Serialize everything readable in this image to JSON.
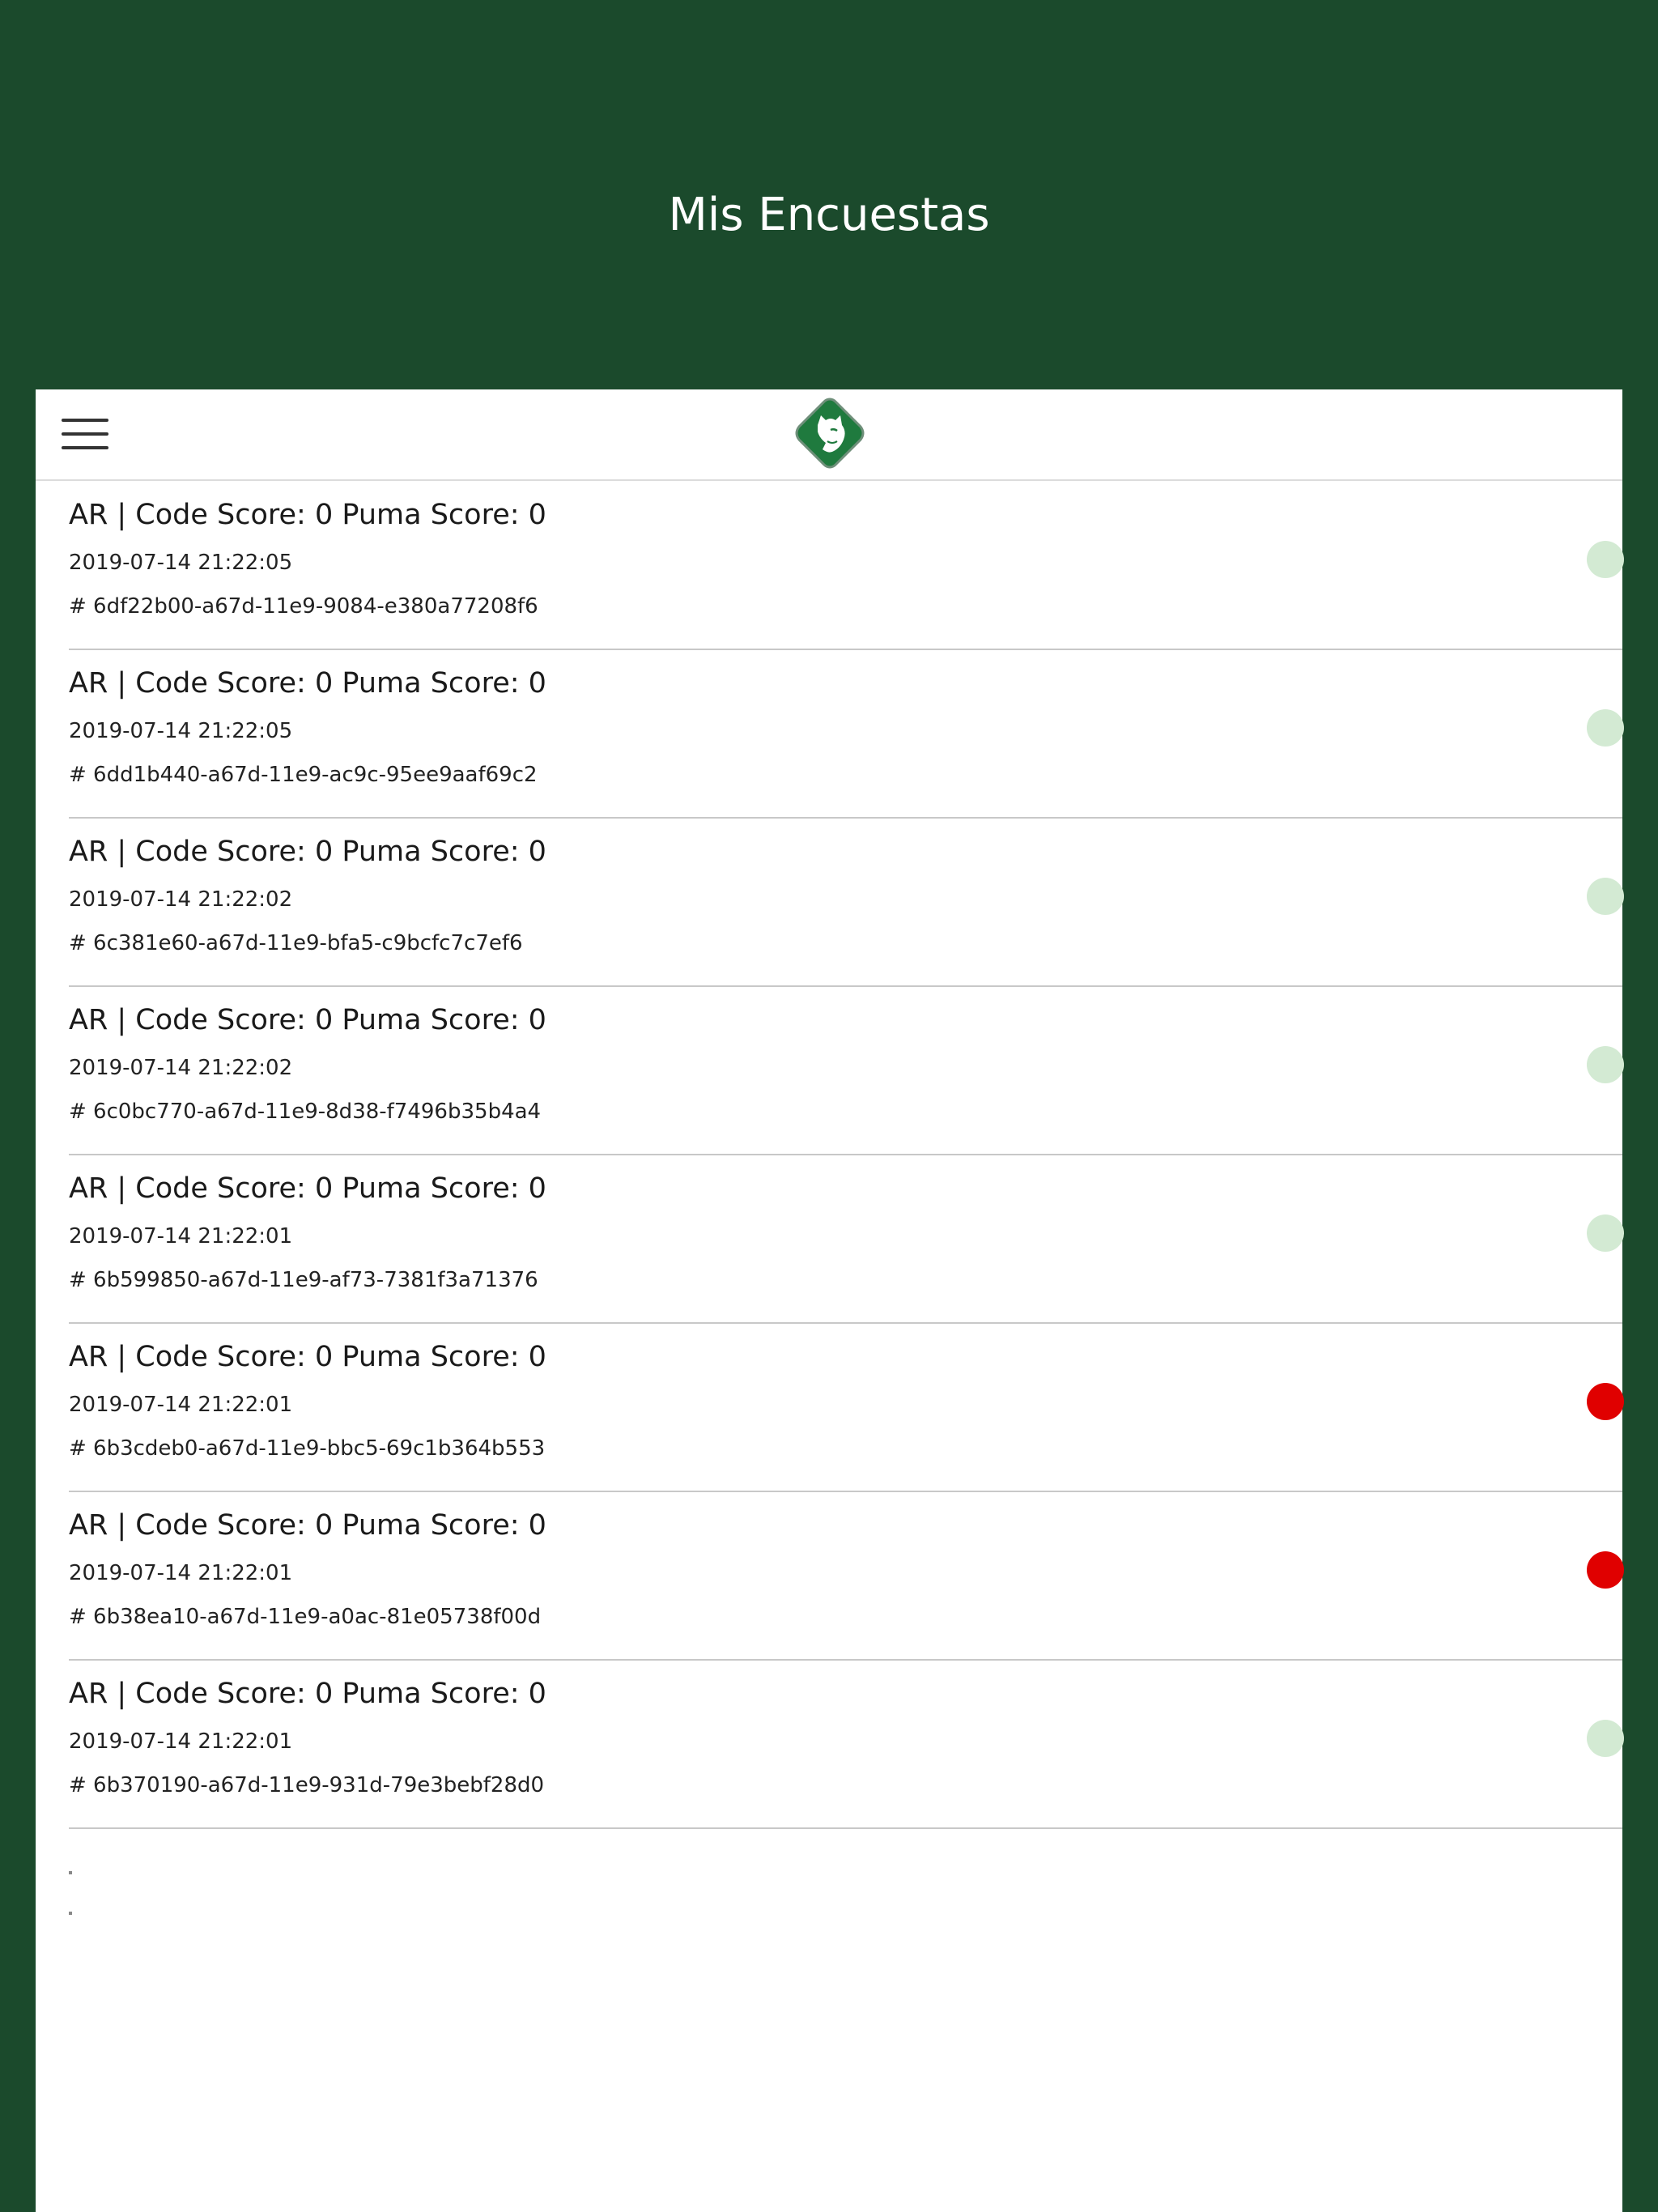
{
  "page": {
    "title": "Mis Encuestas"
  },
  "colors": {
    "header_bg": "#1b4a2c",
    "panel_bg": "#ffffff",
    "logo_green": "#1f7a3e",
    "status_ok": "#d3ead3",
    "status_alert": "#e00000"
  },
  "toolbar": {
    "menu_icon": "hamburger-menu-icon",
    "logo_icon": "puma-logo-icon"
  },
  "surveys": [
    {
      "title": "AR | Code Score: 0 Puma Score: 0",
      "date": "2019-07-14 21:22:05",
      "id": "# 6df22b00-a67d-11e9-9084-e380a77208f6",
      "status": "ok"
    },
    {
      "title": "AR | Code Score: 0 Puma Score: 0",
      "date": "2019-07-14 21:22:05",
      "id": "# 6dd1b440-a67d-11e9-ac9c-95ee9aaf69c2",
      "status": "ok"
    },
    {
      "title": "AR | Code Score: 0 Puma Score: 0",
      "date": "2019-07-14 21:22:02",
      "id": "# 6c381e60-a67d-11e9-bfa5-c9bcfc7c7ef6",
      "status": "ok"
    },
    {
      "title": "AR | Code Score: 0 Puma Score: 0",
      "date": "2019-07-14 21:22:02",
      "id": "# 6c0bc770-a67d-11e9-8d38-f7496b35b4a4",
      "status": "ok"
    },
    {
      "title": "AR | Code Score: 0 Puma Score: 0",
      "date": "2019-07-14 21:22:01",
      "id": "# 6b599850-a67d-11e9-af73-7381f3a71376",
      "status": "ok"
    },
    {
      "title": "AR | Code Score: 0 Puma Score: 0",
      "date": "2019-07-14 21:22:01",
      "id": "# 6b3cdeb0-a67d-11e9-bbc5-69c1b364b553",
      "status": "alert"
    },
    {
      "title": "AR | Code Score: 0 Puma Score: 0",
      "date": "2019-07-14 21:22:01",
      "id": "# 6b38ea10-a67d-11e9-a0ac-81e05738f00d",
      "status": "alert"
    },
    {
      "title": "AR | Code Score: 0 Puma Score: 0",
      "date": "2019-07-14 21:22:01",
      "id": "# 6b370190-a67d-11e9-931d-79e3bebf28d0",
      "status": "ok"
    }
  ]
}
